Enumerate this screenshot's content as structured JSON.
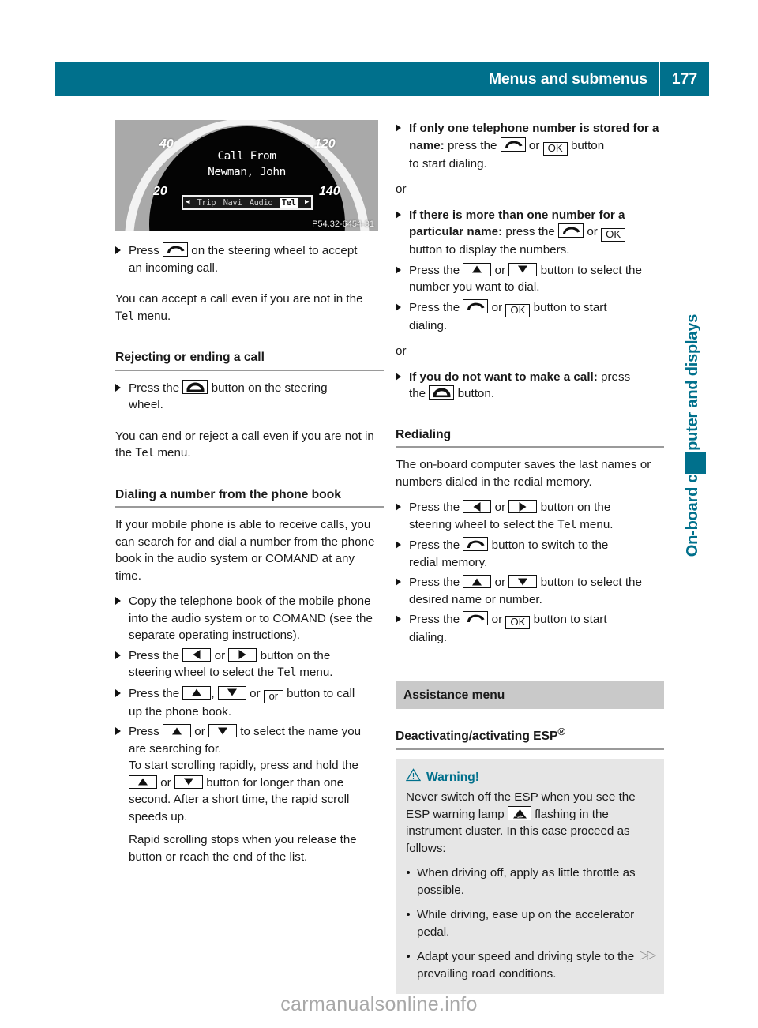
{
  "header": {
    "title": "Menus and submenus",
    "page_number": "177",
    "accent_color": "#00708c"
  },
  "side_tab": {
    "label": "On-board computer and displays"
  },
  "figure": {
    "name": "instrument-cluster-incoming-call",
    "speed_labels": [
      "40",
      "120",
      "20",
      "140"
    ],
    "display_line1": "Call From",
    "display_line2": "Newman, John",
    "menu_items": [
      "Trip",
      "Navi",
      "Audio",
      "Tel"
    ],
    "menu_selected": "Tel",
    "caption": "P54.32-6454-31"
  },
  "left_column": {
    "step_accept_1": "Press",
    "step_accept_2": "on the steering wheel to accept",
    "step_accept_3": "an incoming call.",
    "para_accept": "You can accept a call even if you are not in the ",
    "para_accept_menu": "Tel",
    "para_accept_end": " menu.",
    "heading_reject": "Rejecting or ending a call",
    "step_reject_1": "Press the",
    "step_reject_2": "button on the steering",
    "step_reject_3": "wheel.",
    "para_reject": "You can end or reject a call even if you are not in the ",
    "para_reject_menu": "Tel",
    "para_reject_end": " menu.",
    "heading_phonebook": "Dialing a number from the phone book",
    "para_phonebook": "If your mobile phone is able to receive calls, you can search for and dial a number from the phone book in the audio system or COMAND at any time.",
    "step_copy": "Copy the telephone book of the mobile phone into the audio system or to COMAND (see the separate operating instructions).",
    "step_select_tel_1": "Press the",
    "step_select_tel_or": "or",
    "step_select_tel_2": "button on the",
    "step_select_tel_3": "steering wheel to select the ",
    "step_select_tel_menu": "Tel",
    "step_select_tel_4": " menu.",
    "step_callup_1": "Press the",
    "step_callup_comma": ",",
    "step_callup_or": "or",
    "step_callup_2": "button to call",
    "step_callup_3": "up the phone book.",
    "step_name_1": "Press",
    "step_name_or": "or",
    "step_name_2": "to select the name you",
    "step_name_3": "are searching for.",
    "scroll_line1": "To start scrolling rapidly, press and hold the",
    "scroll_or": "or",
    "scroll_line2": "button for longer than one",
    "scroll_line3": "second. After a short time, the rapid scroll speeds up.",
    "scroll_stop": "Rapid scrolling stops when you release the button or reach the end of the list."
  },
  "right_column": {
    "step_one_number_bold": "If only one telephone number is stored for a name:",
    "step_one_number_rest": " press the",
    "step_one_number_or": "or",
    "step_one_number_tail": "button",
    "step_one_number_line3": "to start dialing.",
    "or_1": "or",
    "step_more_numbers_bold": "If there is more than one number for a particular name:",
    "step_more_numbers_rest": " press the",
    "step_more_numbers_or": "or",
    "step_more_numbers_line3": "button to display the numbers.",
    "step_select_number_1": "Press the",
    "step_select_number_or": "or",
    "step_select_number_2": "button to select the",
    "step_select_number_3": "number you want to dial.",
    "step_start_dial_1": "Press the",
    "step_start_dial_or": "or",
    "step_start_dial_2": "button to start",
    "step_start_dial_3": "dialing.",
    "or_2": "or",
    "step_no_call_bold": "If you do not want to make a call:",
    "step_no_call_rest": " press",
    "step_no_call_line2a": "the",
    "step_no_call_line2b": "button.",
    "heading_redialing": "Redialing",
    "para_redialing": "The on-board computer saves the last names or numbers dialed in the redial memory.",
    "redial_step1_1": "Press the",
    "redial_step1_or": "or",
    "redial_step1_2": "button on the",
    "redial_step1_3": "steering wheel to select the ",
    "redial_step1_menu": "Tel",
    "redial_step1_4": " menu.",
    "redial_step2_1": "Press the",
    "redial_step2_2": "button to switch to the",
    "redial_step2_3": "redial memory.",
    "redial_step3_1": "Press the",
    "redial_step3_or": "or",
    "redial_step3_2": "button to select the",
    "redial_step3_3": "desired name or number.",
    "redial_step4_1": "Press the",
    "redial_step4_or": "or",
    "redial_step4_2": "button to start",
    "redial_step4_3": "dialing.",
    "section_assistance": "Assistance menu",
    "heading_esp": "Deactivating/activating ESP",
    "heading_esp_sup": "®",
    "warning": {
      "title": "Warning!",
      "body_1": "Never switch off the ESP when you see the ESP warning lamp",
      "body_2": "flashing in the instrument cluster. In this case proceed as follows:",
      "bullets": [
        "When driving off, apply as little throttle as possible.",
        "While driving, ease up on the accelerator pedal.",
        "Adapt your speed and driving style to the prevailing road conditions."
      ]
    }
  },
  "footer": {
    "continue_arrows": "▷▷",
    "watermark": "carmanualsonline.info"
  }
}
